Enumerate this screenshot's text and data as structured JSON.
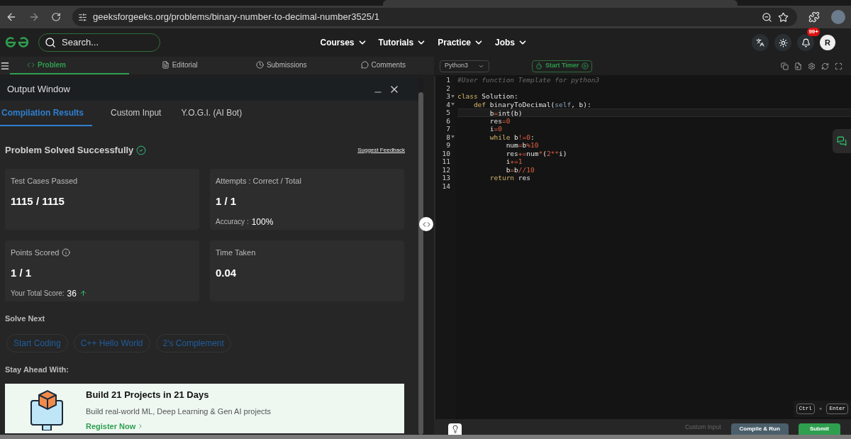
{
  "browser": {
    "url": "geeksforgeeks.org/problems/binary-number-to-decimal-number3525/1"
  },
  "site_nav": {
    "search_placeholder": "Search...",
    "menus": [
      "Courses",
      "Tutorials",
      "Practice",
      "Jobs"
    ],
    "notification_badge": "99+",
    "avatar_initial": "R"
  },
  "problem_tabs": [
    {
      "label": "Problem",
      "selected": true
    },
    {
      "label": "Editorial",
      "selected": false
    },
    {
      "label": "Submissions",
      "selected": false
    },
    {
      "label": "Comments",
      "selected": false
    }
  ],
  "output_window": {
    "title": "Output Window",
    "tabs": [
      {
        "label": "Compilation Results",
        "selected": true
      },
      {
        "label": "Custom Input",
        "selected": false
      },
      {
        "label": "Y.O.G.I. (AI Bot)",
        "selected": false
      }
    ],
    "status": "Problem Solved Successfully",
    "feedback_link": "Suggest Feedback",
    "cards": [
      {
        "label": "Test Cases Passed",
        "value": "1115 / 1115"
      },
      {
        "label": "Attempts : Correct / Total",
        "value": "1 / 1",
        "note_label": "Accuracy :",
        "note_value": "100%"
      },
      {
        "label": "Points Scored",
        "value": "1 / 1",
        "info": true,
        "note_label": "Your Total Score:",
        "note_value": "36",
        "trend_up": true
      },
      {
        "label": "Time Taken",
        "value": "0.04"
      }
    ],
    "solve_next_title": "Solve Next",
    "solve_next": [
      "Start Coding",
      "C++ Hello World",
      "2's Complement"
    ],
    "stay_ahead_title": "Stay Ahead With:",
    "promo": {
      "title": "Build 21 Projects in 21 Days",
      "text": "Build real-world ML, Deep Learning & Gen AI projects",
      "link": "Register Now"
    }
  },
  "editor": {
    "language": "Python3",
    "timer_button": "Start Timer",
    "lines": [
      {
        "number": "1",
        "current": false,
        "foldable": false,
        "tokens": [
          {
            "kind": "comment",
            "text": "#User function Template for python3"
          }
        ]
      },
      {
        "number": "2",
        "current": false,
        "foldable": false
      },
      {
        "number": "3",
        "current": false,
        "foldable": true,
        "tokens": [
          {
            "kind": "keyword",
            "text": "class"
          },
          {
            "kind": "plain",
            "text": " Solution:"
          }
        ]
      },
      {
        "number": "4",
        "current": false,
        "foldable": true,
        "tokens": [
          {
            "kind": "keyword",
            "text": "    def"
          },
          {
            "kind": "plain",
            "text": " binaryToDecimal("
          },
          {
            "kind": "self",
            "text": "self"
          },
          {
            "kind": "plain",
            "text": ", b):"
          }
        ]
      },
      {
        "number": "5",
        "current": true,
        "foldable": false,
        "tokens": [
          {
            "kind": "plain",
            "text": "        b"
          },
          {
            "kind": "operator",
            "text": "="
          },
          {
            "kind": "plain",
            "text": "int(b)"
          }
        ]
      },
      {
        "number": "6",
        "current": false,
        "foldable": false,
        "tokens": [
          {
            "kind": "plain",
            "text": "        res"
          },
          {
            "kind": "operator",
            "text": "=0"
          }
        ]
      },
      {
        "number": "7",
        "current": false,
        "foldable": false,
        "tokens": [
          {
            "kind": "plain",
            "text": "        i"
          },
          {
            "kind": "operator",
            "text": "=0"
          }
        ]
      },
      {
        "number": "8",
        "current": false,
        "foldable": true,
        "tokens": [
          {
            "kind": "keyword",
            "text": "        while"
          },
          {
            "kind": "plain",
            "text": " b"
          },
          {
            "kind": "operator",
            "text": "!=0"
          },
          {
            "kind": "plain",
            "text": ":"
          }
        ]
      },
      {
        "number": "9",
        "current": false,
        "foldable": false,
        "tokens": [
          {
            "kind": "plain",
            "text": "            num"
          },
          {
            "kind": "operator",
            "text": "="
          },
          {
            "kind": "plain",
            "text": "b"
          },
          {
            "kind": "operator",
            "text": "%10"
          }
        ]
      },
      {
        "number": "10",
        "current": false,
        "foldable": false,
        "tokens": [
          {
            "kind": "plain",
            "text": "            res"
          },
          {
            "kind": "operator",
            "text": "+="
          },
          {
            "kind": "plain",
            "text": "num"
          },
          {
            "kind": "operator",
            "text": "*"
          },
          {
            "kind": "plain",
            "text": "("
          },
          {
            "kind": "operator",
            "text": "2**"
          },
          {
            "kind": "plain",
            "text": "i)"
          }
        ]
      },
      {
        "number": "11",
        "current": false,
        "foldable": false,
        "tokens": [
          {
            "kind": "plain",
            "text": "            i"
          },
          {
            "kind": "operator",
            "text": "+=1"
          }
        ]
      },
      {
        "number": "12",
        "current": false,
        "foldable": false,
        "tokens": [
          {
            "kind": "plain",
            "text": "            b"
          },
          {
            "kind": "operator",
            "text": "="
          },
          {
            "kind": "plain",
            "text": "b"
          },
          {
            "kind": "operator",
            "text": "//10"
          }
        ]
      },
      {
        "number": "13",
        "current": false,
        "foldable": false,
        "tokens": [
          {
            "kind": "keyword",
            "text": "        return"
          },
          {
            "kind": "plain",
            "text": " res"
          }
        ]
      },
      {
        "number": "14",
        "current": false,
        "foldable": false
      }
    ],
    "shortcut_keys": [
      "Ctrl",
      "+",
      "Enter"
    ],
    "custom_input": "Custom Input",
    "compile_button": "Compile & Run",
    "submit_button": "Submit"
  }
}
